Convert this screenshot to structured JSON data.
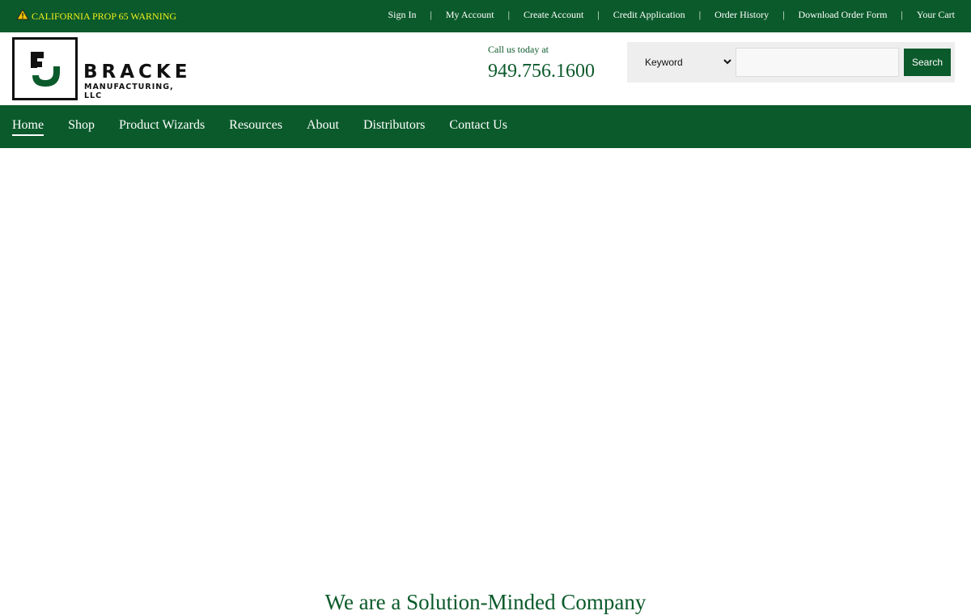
{
  "topbar": {
    "warning": "CALIFORNIA PROP 65 WARNING",
    "links": [
      "Sign In",
      "My Account",
      "Create Account",
      "Credit Application",
      "Order History",
      "Download Order Form",
      "Your Cart"
    ],
    "separator": "|"
  },
  "logo": {
    "word": "BRACKE",
    "sub": "MANUFACTURING, LLC"
  },
  "contact": {
    "label": "Call us today at",
    "phone": "949.756.1600"
  },
  "search": {
    "select_value": "Keyword",
    "button_label": "Search"
  },
  "nav": {
    "items": [
      "Home",
      "Shop",
      "Product Wizards",
      "Resources",
      "About",
      "Distributors",
      "Contact Us"
    ],
    "active": "Home"
  },
  "main": {
    "headline": "We are a Solution-Minded Company"
  },
  "colors": {
    "brand_green": "#0b5a2b",
    "warning_yellow": "#f0f01a"
  },
  "icons": {
    "warning": "warning-triangle-icon"
  }
}
